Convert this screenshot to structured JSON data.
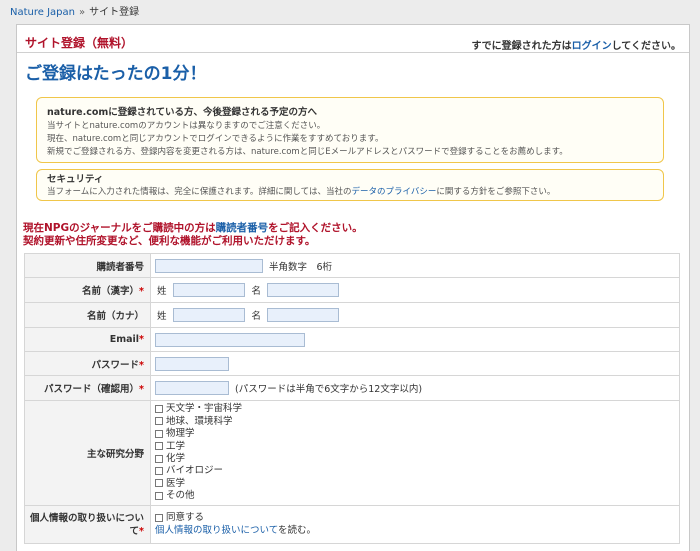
{
  "breadcrumb": {
    "home": "Nature Japan",
    "separator": "»",
    "current": "サイト登録"
  },
  "header": {
    "title": "サイト登録（無料）",
    "login_prefix": "すでに登録された方は",
    "login_link": "ログイン",
    "login_suffix": "してください。"
  },
  "subtitle": "ご登録はたったの1分！",
  "note1": {
    "heading": "nature.comに登録されている方、今後登録される予定の方へ",
    "lines": [
      "当サイトとnature.comのアカウントは異なりますのでご注意ください。",
      "現在、nature.comと同じアカウントでログインできるように作業をすすめております。",
      "新規でご登録される方、登録内容を変更される方は、nature.comと同じEメールアドレスとパスワードで登録することをお薦めします。"
    ]
  },
  "note2": {
    "heading": "セキュリティ",
    "text_prefix": "当フォームに入力された情報は、完全に保護されます。詳細に関しては、当社の",
    "link": "データのプライバシー",
    "text_suffix": "に関する方針をご参照下さい。"
  },
  "npg": {
    "line1_prefix": "現在NPGのジャーナルをご購読中の方は",
    "line1_link": "購読者番号",
    "line1_suffix": "をご記入ください。",
    "line2": "契約更新や住所変更など、便利な機能がご利用いただけます。"
  },
  "form": {
    "subscriber": {
      "label": "購読者番号",
      "hint": "半角数字　6桁"
    },
    "name_kanji": {
      "label": "名前（漢字）",
      "last": "姓",
      "first": "名"
    },
    "name_kana": {
      "label": "名前（カナ）",
      "last": "姓",
      "first": "名"
    },
    "email": {
      "label": "Email"
    },
    "password": {
      "label": "パスワード"
    },
    "password_confirm": {
      "label": "パスワード（確認用）",
      "hint": "(パスワードは半角で6文字から12文字以内)"
    },
    "research": {
      "label": "主な研究分野",
      "options": [
        "天文学・宇宙科学",
        "地球、環境科学",
        "物理学",
        "工学",
        "化学",
        "バイオロジー",
        "医学",
        "その他"
      ]
    },
    "privacy": {
      "label": "個人情報の取り扱いについて",
      "agree": "同意する",
      "link": "個人情報の取り扱いについて",
      "suffix": "を読む。"
    },
    "required_mark": "*"
  },
  "colors": {
    "accent_red": "#b0132b",
    "link_blue": "#1a5fa8",
    "note_border": "#f0c64a"
  }
}
